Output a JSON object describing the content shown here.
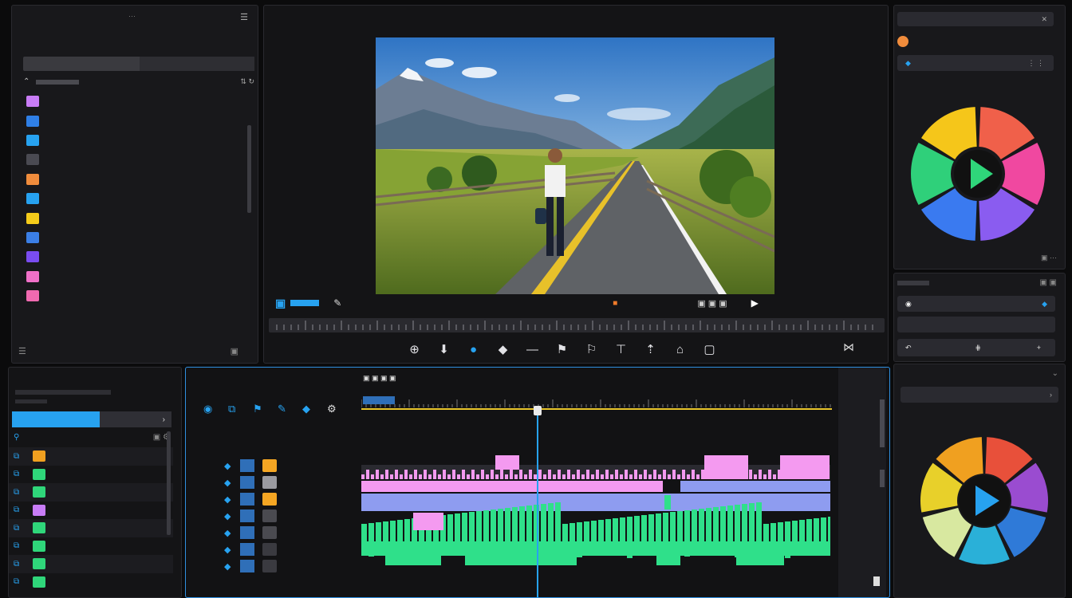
{
  "project_panel": {
    "title": "",
    "subtitle": "",
    "search_value": "",
    "assets": [
      {
        "name": "",
        "color": "#c87cf6"
      },
      {
        "name": "",
        "color": "#2f7fe6"
      },
      {
        "name": "",
        "color": "#27a2f0"
      },
      {
        "name": "",
        "color": "#4a4a52"
      },
      {
        "name": "",
        "color": "#f08c3c"
      },
      {
        "name": "",
        "color": "#27a2f0"
      },
      {
        "name": "",
        "color": "#f5cc1a"
      },
      {
        "name": "",
        "color": "#3b7fe6"
      },
      {
        "name": "",
        "color": "#7a4cf0"
      },
      {
        "name": "",
        "color": "#f070c8"
      },
      {
        "name": "",
        "color": "#f06ab0"
      }
    ]
  },
  "viewer": {
    "tabs": [
      "",
      ""
    ],
    "footer_right": ""
  },
  "right_panels": {
    "top_title": "",
    "item_label": "",
    "wheel_label": "",
    "mid_field": "",
    "mid_field2": "",
    "bottom_title": "",
    "bottom_field": "",
    "bottom_wheel_label": ""
  },
  "media_panel": {
    "title": "",
    "selected_tab": "",
    "items": [
      "",
      "",
      "",
      "",
      "",
      "",
      "",
      ""
    ]
  },
  "timeline": {
    "title": "",
    "project_name": "",
    "timecodes": [
      "",
      "",
      "",
      "",
      "",
      "",
      ""
    ],
    "track_names": [
      "",
      "",
      "",
      "",
      "",
      "",
      ""
    ]
  },
  "colors": {
    "accent": "#27a2f0",
    "pink_clip": "#f49af0",
    "blue_clip": "#8e9cf0",
    "green_clip": "#2fe08a",
    "playhead": "#27a2f0",
    "ruler_line": "#e8c52a"
  }
}
